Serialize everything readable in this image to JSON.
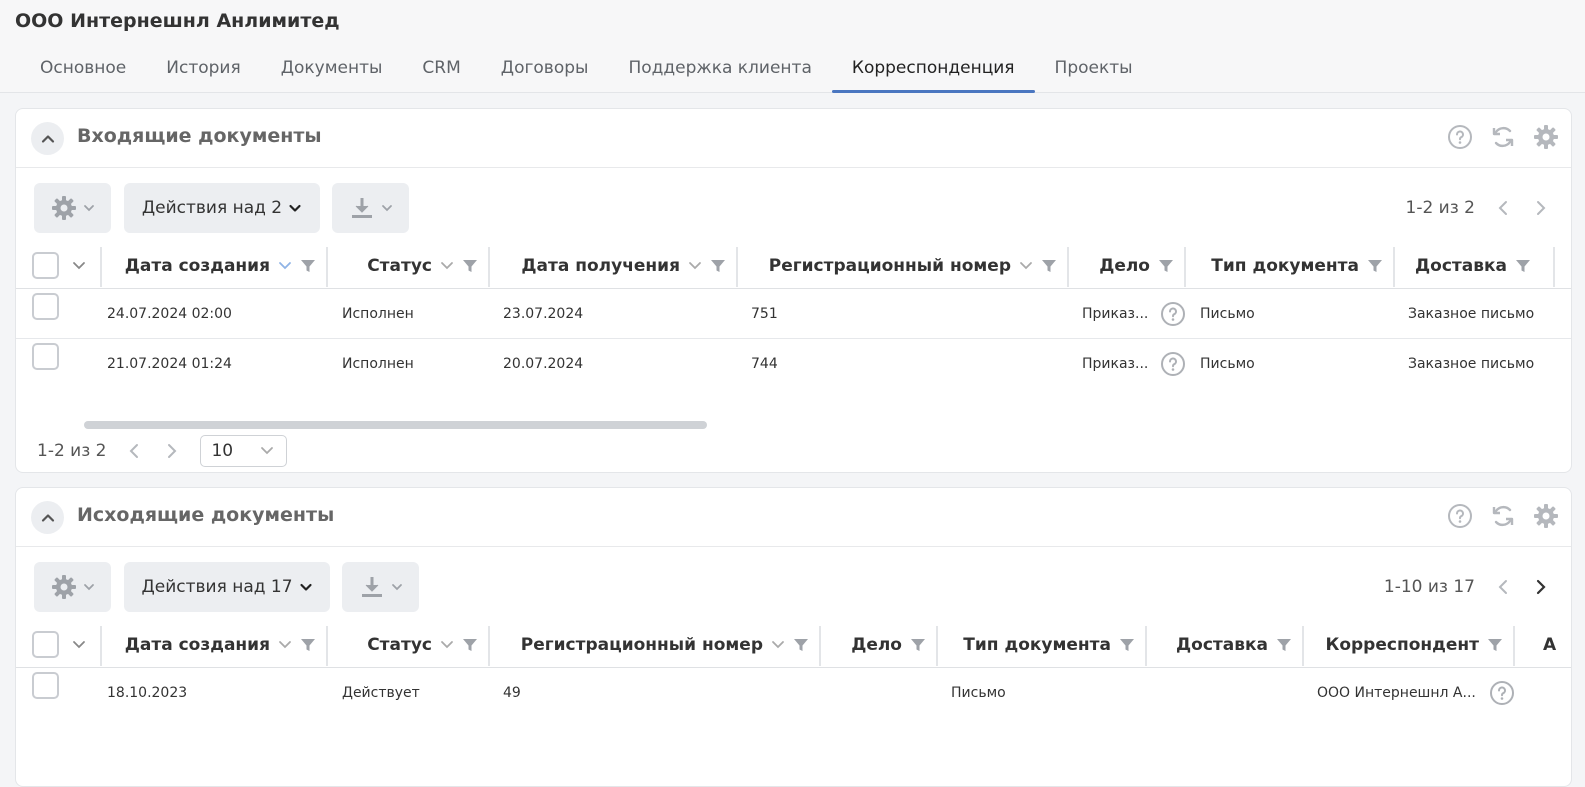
{
  "company": {
    "title": "ООО Интернешнл Анлимитед"
  },
  "tabs": [
    {
      "label": "Основное"
    },
    {
      "label": "История"
    },
    {
      "label": "Документы"
    },
    {
      "label": "CRM"
    },
    {
      "label": "Договоры"
    },
    {
      "label": "Поддержка клиента"
    },
    {
      "label": "Корреспонденция",
      "active": true
    },
    {
      "label": "Проекты"
    }
  ],
  "incoming": {
    "title": "Входящие документы",
    "actions_label": "Действия над 2",
    "pager_top": "1-2 из 2",
    "pager_bottom": "1-2 из 2",
    "page_size": "10",
    "columns": [
      "Дата создания",
      "Статус",
      "Дата получения",
      "Регистрационный номер",
      "Дело",
      "Тип документа",
      "Доставка"
    ],
    "rows": [
      {
        "created": "24.07.2024 02:00",
        "status": "Исполнен",
        "received": "23.07.2024",
        "reg": "751",
        "case": "Приказ...",
        "type": "Письмо",
        "delivery": "Заказное письмо"
      },
      {
        "created": "21.07.2024 01:24",
        "status": "Исполнен",
        "received": "20.07.2024",
        "reg": "744",
        "case": "Приказ...",
        "type": "Письмо",
        "delivery": "Заказное письмо"
      }
    ]
  },
  "outgoing": {
    "title": "Исходящие документы",
    "actions_label": "Действия над 17",
    "pager_top": "1-10 из 17",
    "columns": [
      "Дата создания",
      "Статус",
      "Регистрационный номер",
      "Дело",
      "Тип документа",
      "Доставка",
      "Корреспондент",
      "А"
    ],
    "rows": [
      {
        "created": "18.10.2023",
        "status": "Действует",
        "reg": "49",
        "case": "",
        "type": "Письмо",
        "delivery": "",
        "correspondent": "ООО Интернешнл А..."
      }
    ]
  },
  "colors": {
    "accent": "#4a76c0",
    "panel_bg": "#ffffff",
    "button_bg": "#eceef1"
  }
}
